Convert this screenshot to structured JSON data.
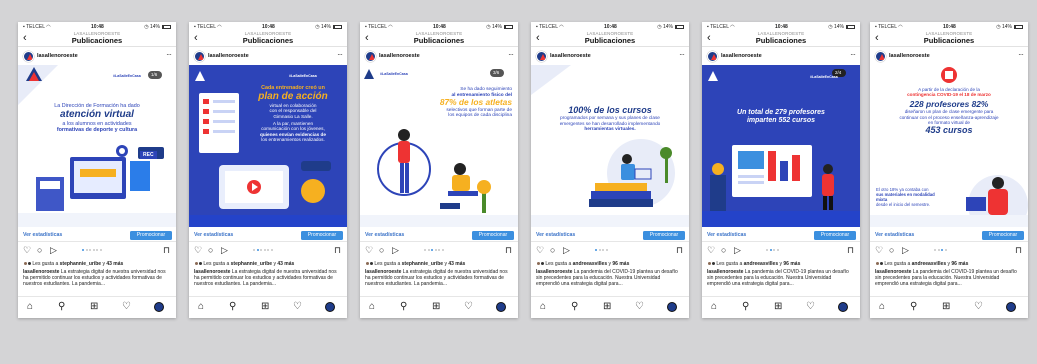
{
  "background_color": "#d4d4d6",
  "common": {
    "account": "LASALLENOROESTE",
    "title": "Publicaciones",
    "username": "lasallenoroeste",
    "more": "···",
    "stats_label": "Ver estadísticas",
    "promote_label": "Promocionar",
    "back_icon": "chevron-left-icon",
    "likes_prefix": "Les gusta a",
    "likes_and": "y",
    "brand_tag": "#LaSalleEnCasa"
  },
  "phones": [
    {
      "carrier": "TELCEL",
      "time": "10:48",
      "battery": "14%",
      "liker": "stephannie_uribe",
      "likes_more": "43 más",
      "caption": "La estrategia digital de nuestra universidad nos ha permitido continuar los estudios y actividades formativas de nuestros estudiantes. La pandemia...",
      "counter": "1/6",
      "slide_lines": [
        "La Dirección de Formación ha dado",
        "atención virtual",
        "a los alumnos en actividades",
        "formativas de deporte y cultura"
      ],
      "rec": "REC"
    },
    {
      "carrier": "TELCEL",
      "time": "10:48",
      "battery": "14%",
      "liker": "stephannie_uribe",
      "likes_more": "43 más",
      "caption": "La estrategia digital de nuestra universidad nos ha permitido continuar los estudios y actividades formativas de nuestros estudiantes. La pandemia...",
      "counter": "",
      "slide_lines": [
        "Cada entrenador creó un",
        "plan de acción",
        "virtual en colaboración",
        "con el responsable del",
        "Gimnasio La Salle.",
        "A la par, mantienen",
        "comunicación con los jóvenes,",
        "quienes envían evidencias de",
        "los entrenamientos realizados."
      ]
    },
    {
      "carrier": "TELCEL",
      "time": "10:48",
      "battery": "14%",
      "liker": "stephannie_uribe",
      "likes_more": "43 más",
      "caption": "La estrategia digital de nuestra universidad nos ha permitido continuar los estudios y actividades formativas de nuestros estudiantes. La pandemia...",
      "counter": "3/6",
      "slide_lines": [
        "Se ha dado seguimiento",
        "al entrenamiento físico del",
        "87% de los atletas",
        "selectivos que forman parte de",
        "los equipos de cada disciplina"
      ]
    },
    {
      "carrier": "TELCEL",
      "time": "10:48",
      "battery": "14%",
      "liker": "andreeasvilles",
      "likes_more": "96 más",
      "caption": "La pandemia del COVID-19 plantea un desafío sin precedentes para la educación. Nuestra Universidad emprendió una estrategia digital para...",
      "counter": "",
      "slide_lines": [
        "100% de los cursos",
        "programados por semana y sus planes de clase",
        "emergentes se han desarrollado implementando",
        "herramientas virtuales."
      ]
    },
    {
      "carrier": "TELCEL",
      "time": "10:48",
      "battery": "14%",
      "liker": "andreeasvilles",
      "likes_more": "96 más",
      "caption": "La pandemia del COVID-19 plantea un desafío sin precedentes para la educación. Nuestra Universidad emprendió una estrategia digital para...",
      "counter": "2/4",
      "slide_lines": [
        "Un total de 279 profesores",
        "imparten 552 cursos"
      ]
    },
    {
      "carrier": "TELCEL",
      "time": "10:48",
      "battery": "14%",
      "liker": "andreeasvilles",
      "likes_more": "96 más",
      "caption": "La pandemia del COVID-19 plantea un desafío sin precedentes para la educación. Nuestra Universidad emprendió una estrategia digital para...",
      "counter": "",
      "slide_lines": [
        "A partir de la declaración de la",
        "contingencia COVID-19 el 18 de marzo",
        "228 profesores 82%",
        "diseñaron un plan de clase emergente para",
        "continuar con el proceso enseñanza-aprendizaje",
        "en formato virtual de",
        "453 cursos",
        "El otro 18% ya contaba con",
        "sus materiales en modalidad mixta",
        "desde el inicio del semestre."
      ]
    }
  ]
}
